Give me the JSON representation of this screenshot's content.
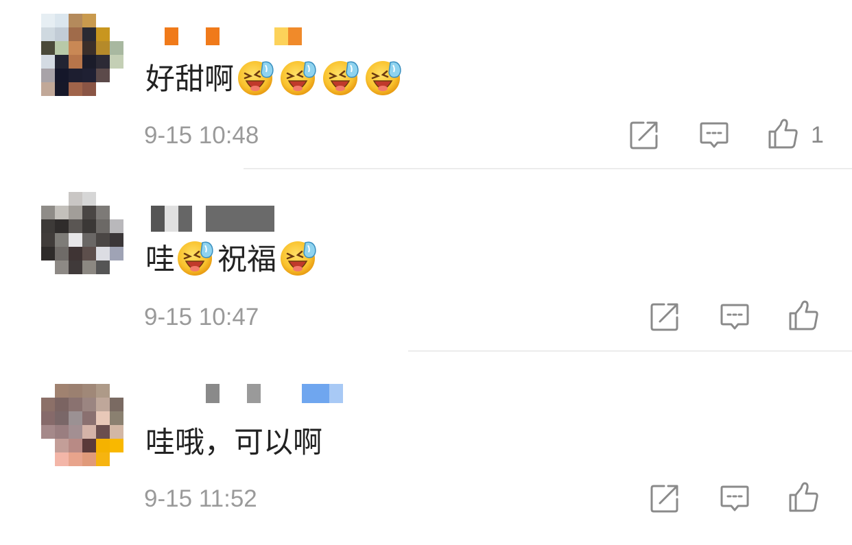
{
  "comments": [
    {
      "text": "好甜啊",
      "emoji_count": 4,
      "timestamp": "9-15 10:48",
      "likes": "1",
      "emoji_icon": "laugh-cry-emoji-icon"
    },
    {
      "text_part1": "哇",
      "text_part2": "祝福",
      "timestamp": "9-15 10:47",
      "likes": "",
      "emoji_icon": "laugh-cry-emoji-icon"
    },
    {
      "text": "哇哦，可以啊",
      "timestamp": "9-15 11:52",
      "likes": ""
    }
  ],
  "icons": {
    "share": "share-icon",
    "reply": "comment-icon",
    "like": "thumbs-up-icon"
  },
  "colors": {
    "text": "#222222",
    "meta": "#9a9a9a",
    "icon": "#8a8a8a",
    "divider": "#ececec",
    "emoji_face": "#f7b52c"
  }
}
